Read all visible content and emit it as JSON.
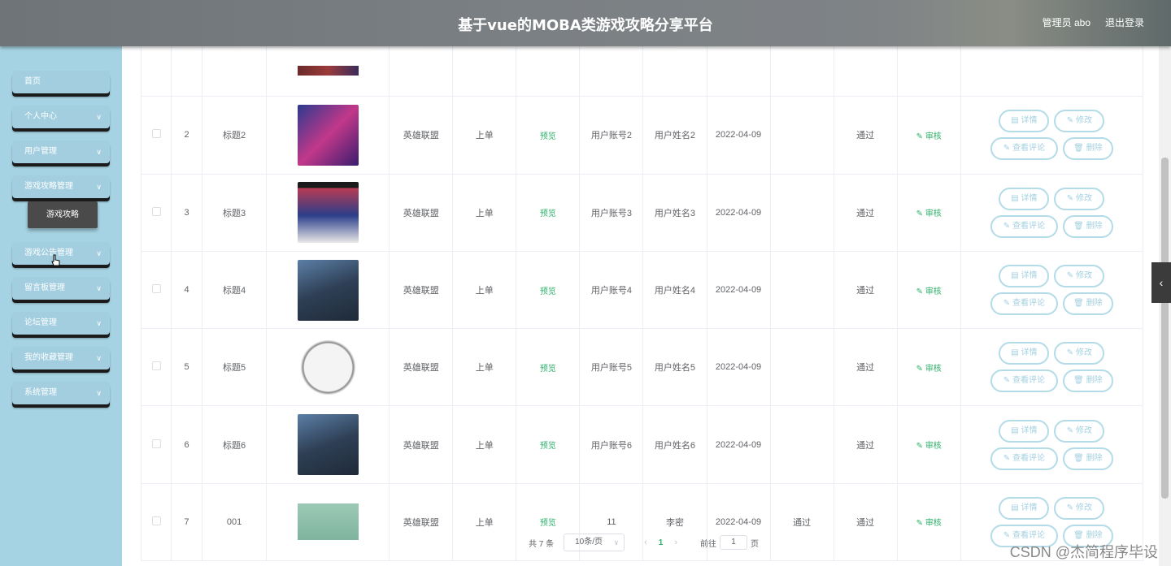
{
  "header": {
    "title": "基于vue的MOBA类游戏攻略分享平台",
    "user": "管理员 abo",
    "logout": "退出登录"
  },
  "sidebar": {
    "items": [
      {
        "label": "首页"
      },
      {
        "label": "个人中心"
      },
      {
        "label": "用户管理"
      },
      {
        "label": "游戏攻略管理"
      },
      {
        "label": "游戏公告管理"
      },
      {
        "label": "留言板管理"
      },
      {
        "label": "论坛管理"
      },
      {
        "label": "我的收藏管理"
      },
      {
        "label": "系统管理"
      }
    ],
    "submenu_label": "游戏攻略",
    "chevron": "∨"
  },
  "ops": {
    "detail": "详情",
    "edit": "修改",
    "comments": "查看评论",
    "delete": "删除"
  },
  "audit_label": "审核",
  "rows": [
    {
      "idx": "2",
      "title": "标题2",
      "type": "英雄联盟",
      "position": "上单",
      "preview": "预览",
      "account": "用户账号2",
      "name": "用户姓名2",
      "date": "2022-04-09",
      "reply": "",
      "status": "通过"
    },
    {
      "idx": "3",
      "title": "标题3",
      "type": "英雄联盟",
      "position": "上单",
      "preview": "预览",
      "account": "用户账号3",
      "name": "用户姓名3",
      "date": "2022-04-09",
      "reply": "",
      "status": "通过"
    },
    {
      "idx": "4",
      "title": "标题4",
      "type": "英雄联盟",
      "position": "上单",
      "preview": "预览",
      "account": "用户账号4",
      "name": "用户姓名4",
      "date": "2022-04-09",
      "reply": "",
      "status": "通过"
    },
    {
      "idx": "5",
      "title": "标题5",
      "type": "英雄联盟",
      "position": "上单",
      "preview": "预览",
      "account": "用户账号5",
      "name": "用户姓名5",
      "date": "2022-04-09",
      "reply": "",
      "status": "通过"
    },
    {
      "idx": "6",
      "title": "标题6",
      "type": "英雄联盟",
      "position": "上单",
      "preview": "预览",
      "account": "用户账号6",
      "name": "用户姓名6",
      "date": "2022-04-09",
      "reply": "",
      "status": "通过"
    },
    {
      "idx": "7",
      "title": "001",
      "type": "英雄联盟",
      "position": "上单",
      "preview": "预览",
      "account": "11",
      "name": "李密",
      "date": "2022-04-09",
      "reply": "通过",
      "status": "通过"
    }
  ],
  "pagination": {
    "total": "共 7 条",
    "page_size": "10条/页",
    "current_page": "1",
    "goto_label": "前往",
    "goto_value": "1",
    "page_unit": "页",
    "prev": "‹",
    "next": "›"
  },
  "watermark": "CSDN @杰简程序毕设"
}
